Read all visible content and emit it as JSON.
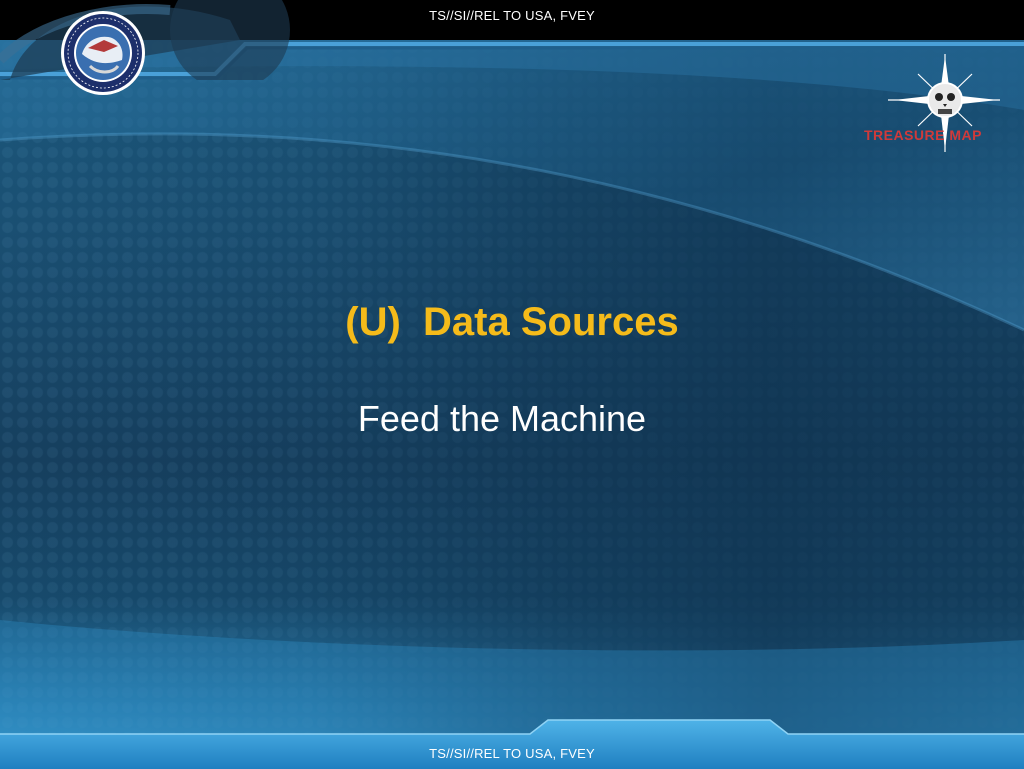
{
  "classification": {
    "top": "TS//SI//REL TO USA, FVEY",
    "bottom": "TS//SI//REL TO USA, FVEY"
  },
  "slide": {
    "title": "(U)  Data Sources",
    "subtitle": "Feed the Machine"
  },
  "logos": {
    "left_seal_icon": "agency-seal-icon",
    "right_program_icon": "compass-skull-logo-icon",
    "right_program_name": "TREASURE MAP"
  },
  "colors": {
    "title": "#f5bb1a",
    "subtitle": "#ffffff",
    "background": "#1a4f72",
    "top_bar": "#000000"
  }
}
